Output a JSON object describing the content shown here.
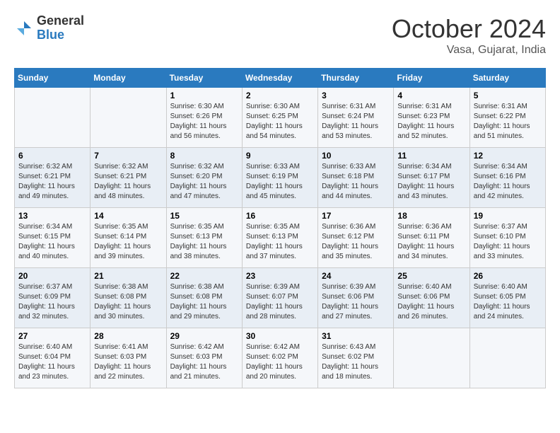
{
  "logo": {
    "general": "General",
    "blue": "Blue"
  },
  "title": "October 2024",
  "location": "Vasa, Gujarat, India",
  "days_of_week": [
    "Sunday",
    "Monday",
    "Tuesday",
    "Wednesday",
    "Thursday",
    "Friday",
    "Saturday"
  ],
  "weeks": [
    [
      {
        "day": "",
        "sunrise": "",
        "sunset": "",
        "daylight": ""
      },
      {
        "day": "",
        "sunrise": "",
        "sunset": "",
        "daylight": ""
      },
      {
        "day": "1",
        "sunrise": "Sunrise: 6:30 AM",
        "sunset": "Sunset: 6:26 PM",
        "daylight": "Daylight: 11 hours and 56 minutes."
      },
      {
        "day": "2",
        "sunrise": "Sunrise: 6:30 AM",
        "sunset": "Sunset: 6:25 PM",
        "daylight": "Daylight: 11 hours and 54 minutes."
      },
      {
        "day": "3",
        "sunrise": "Sunrise: 6:31 AM",
        "sunset": "Sunset: 6:24 PM",
        "daylight": "Daylight: 11 hours and 53 minutes."
      },
      {
        "day": "4",
        "sunrise": "Sunrise: 6:31 AM",
        "sunset": "Sunset: 6:23 PM",
        "daylight": "Daylight: 11 hours and 52 minutes."
      },
      {
        "day": "5",
        "sunrise": "Sunrise: 6:31 AM",
        "sunset": "Sunset: 6:22 PM",
        "daylight": "Daylight: 11 hours and 51 minutes."
      }
    ],
    [
      {
        "day": "6",
        "sunrise": "Sunrise: 6:32 AM",
        "sunset": "Sunset: 6:21 PM",
        "daylight": "Daylight: 11 hours and 49 minutes."
      },
      {
        "day": "7",
        "sunrise": "Sunrise: 6:32 AM",
        "sunset": "Sunset: 6:21 PM",
        "daylight": "Daylight: 11 hours and 48 minutes."
      },
      {
        "day": "8",
        "sunrise": "Sunrise: 6:32 AM",
        "sunset": "Sunset: 6:20 PM",
        "daylight": "Daylight: 11 hours and 47 minutes."
      },
      {
        "day": "9",
        "sunrise": "Sunrise: 6:33 AM",
        "sunset": "Sunset: 6:19 PM",
        "daylight": "Daylight: 11 hours and 45 minutes."
      },
      {
        "day": "10",
        "sunrise": "Sunrise: 6:33 AM",
        "sunset": "Sunset: 6:18 PM",
        "daylight": "Daylight: 11 hours and 44 minutes."
      },
      {
        "day": "11",
        "sunrise": "Sunrise: 6:34 AM",
        "sunset": "Sunset: 6:17 PM",
        "daylight": "Daylight: 11 hours and 43 minutes."
      },
      {
        "day": "12",
        "sunrise": "Sunrise: 6:34 AM",
        "sunset": "Sunset: 6:16 PM",
        "daylight": "Daylight: 11 hours and 42 minutes."
      }
    ],
    [
      {
        "day": "13",
        "sunrise": "Sunrise: 6:34 AM",
        "sunset": "Sunset: 6:15 PM",
        "daylight": "Daylight: 11 hours and 40 minutes."
      },
      {
        "day": "14",
        "sunrise": "Sunrise: 6:35 AM",
        "sunset": "Sunset: 6:14 PM",
        "daylight": "Daylight: 11 hours and 39 minutes."
      },
      {
        "day": "15",
        "sunrise": "Sunrise: 6:35 AM",
        "sunset": "Sunset: 6:13 PM",
        "daylight": "Daylight: 11 hours and 38 minutes."
      },
      {
        "day": "16",
        "sunrise": "Sunrise: 6:35 AM",
        "sunset": "Sunset: 6:13 PM",
        "daylight": "Daylight: 11 hours and 37 minutes."
      },
      {
        "day": "17",
        "sunrise": "Sunrise: 6:36 AM",
        "sunset": "Sunset: 6:12 PM",
        "daylight": "Daylight: 11 hours and 35 minutes."
      },
      {
        "day": "18",
        "sunrise": "Sunrise: 6:36 AM",
        "sunset": "Sunset: 6:11 PM",
        "daylight": "Daylight: 11 hours and 34 minutes."
      },
      {
        "day": "19",
        "sunrise": "Sunrise: 6:37 AM",
        "sunset": "Sunset: 6:10 PM",
        "daylight": "Daylight: 11 hours and 33 minutes."
      }
    ],
    [
      {
        "day": "20",
        "sunrise": "Sunrise: 6:37 AM",
        "sunset": "Sunset: 6:09 PM",
        "daylight": "Daylight: 11 hours and 32 minutes."
      },
      {
        "day": "21",
        "sunrise": "Sunrise: 6:38 AM",
        "sunset": "Sunset: 6:08 PM",
        "daylight": "Daylight: 11 hours and 30 minutes."
      },
      {
        "day": "22",
        "sunrise": "Sunrise: 6:38 AM",
        "sunset": "Sunset: 6:08 PM",
        "daylight": "Daylight: 11 hours and 29 minutes."
      },
      {
        "day": "23",
        "sunrise": "Sunrise: 6:39 AM",
        "sunset": "Sunset: 6:07 PM",
        "daylight": "Daylight: 11 hours and 28 minutes."
      },
      {
        "day": "24",
        "sunrise": "Sunrise: 6:39 AM",
        "sunset": "Sunset: 6:06 PM",
        "daylight": "Daylight: 11 hours and 27 minutes."
      },
      {
        "day": "25",
        "sunrise": "Sunrise: 6:40 AM",
        "sunset": "Sunset: 6:06 PM",
        "daylight": "Daylight: 11 hours and 26 minutes."
      },
      {
        "day": "26",
        "sunrise": "Sunrise: 6:40 AM",
        "sunset": "Sunset: 6:05 PM",
        "daylight": "Daylight: 11 hours and 24 minutes."
      }
    ],
    [
      {
        "day": "27",
        "sunrise": "Sunrise: 6:40 AM",
        "sunset": "Sunset: 6:04 PM",
        "daylight": "Daylight: 11 hours and 23 minutes."
      },
      {
        "day": "28",
        "sunrise": "Sunrise: 6:41 AM",
        "sunset": "Sunset: 6:03 PM",
        "daylight": "Daylight: 11 hours and 22 minutes."
      },
      {
        "day": "29",
        "sunrise": "Sunrise: 6:42 AM",
        "sunset": "Sunset: 6:03 PM",
        "daylight": "Daylight: 11 hours and 21 minutes."
      },
      {
        "day": "30",
        "sunrise": "Sunrise: 6:42 AM",
        "sunset": "Sunset: 6:02 PM",
        "daylight": "Daylight: 11 hours and 20 minutes."
      },
      {
        "day": "31",
        "sunrise": "Sunrise: 6:43 AM",
        "sunset": "Sunset: 6:02 PM",
        "daylight": "Daylight: 11 hours and 18 minutes."
      },
      {
        "day": "",
        "sunrise": "",
        "sunset": "",
        "daylight": ""
      },
      {
        "day": "",
        "sunrise": "",
        "sunset": "",
        "daylight": ""
      }
    ]
  ]
}
